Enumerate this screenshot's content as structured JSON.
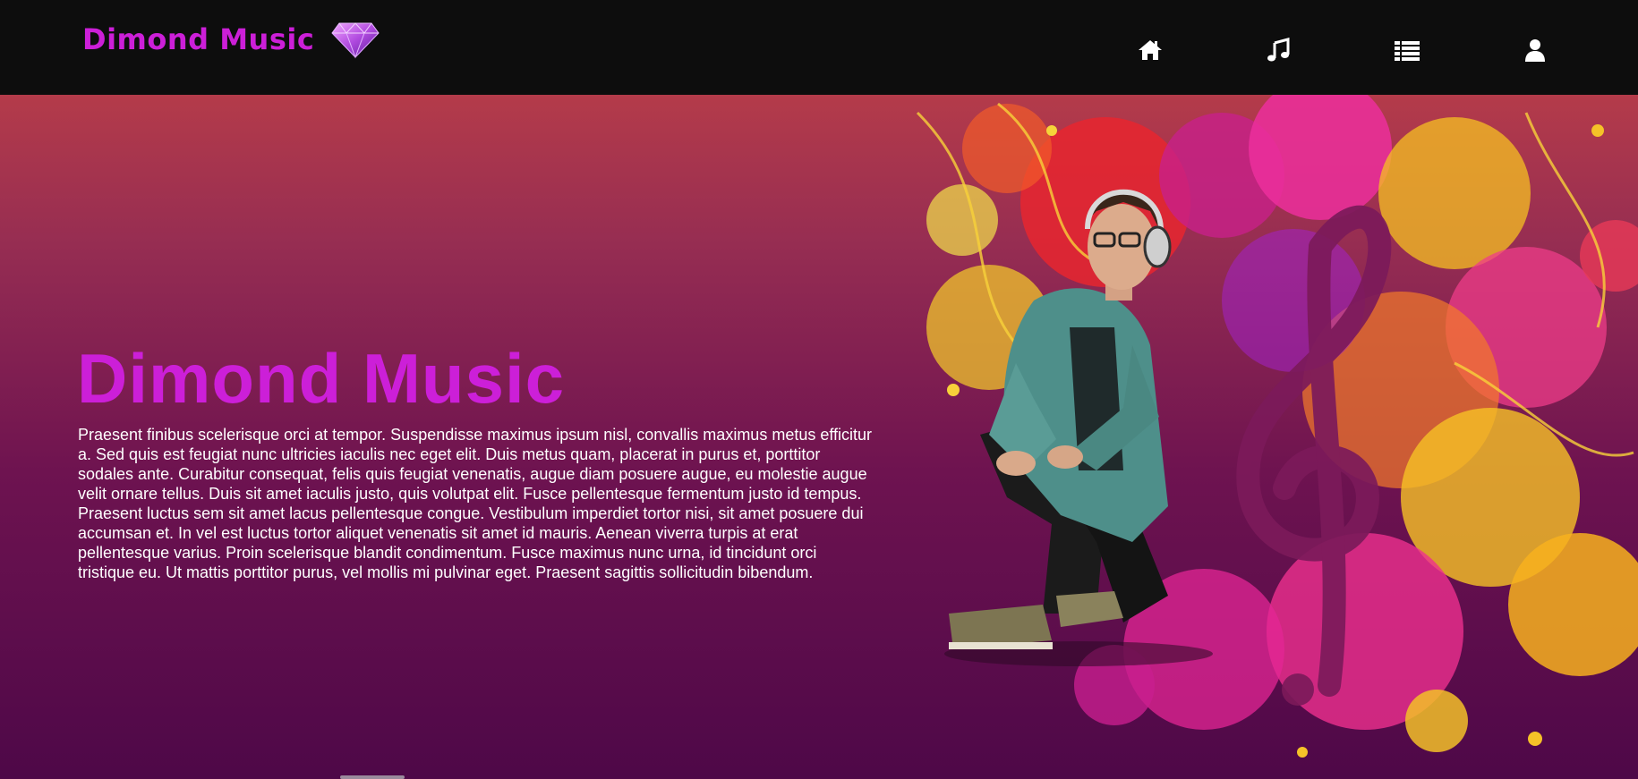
{
  "header": {
    "brand": "Dimond Music",
    "logo_icon": "diamond-icon",
    "nav": [
      {
        "name": "nav-home",
        "icon": "home-icon"
      },
      {
        "name": "nav-music",
        "icon": "music-note-icon"
      },
      {
        "name": "nav-list",
        "icon": "list-icon"
      },
      {
        "name": "nav-profile",
        "icon": "user-icon"
      }
    ]
  },
  "hero": {
    "title": "Dimond Music",
    "body": "Praesent finibus scelerisque orci at tempor. Suspendisse maximus ipsum nisl, convallis maximus metus efficitur a. Sed quis est feugiat nunc ultricies iaculis nec eget elit. Duis metus quam, placerat in purus et, porttitor sodales ante. Curabitur consequat, felis quis feugiat venenatis, augue diam posuere augue, eu molestie augue velit ornare tellus. Duis sit amet iaculis justo, quis volutpat elit. Fusce pellentesque fermentum justo id tempus. Praesent luctus sem sit amet lacus pellentesque congue. Vestibulum imperdiet tortor nisi, sit amet posuere dui accumsan et. In vel est luctus tortor aliquet venenatis sit amet id mauris. Aenean viverra turpis at erat pellentesque varius. Proin scelerisque blandit condimentum. Fusce maximus nunc urna, id tincidunt orci tristique eu. Ut mattis porttitor purus, vel mollis mi pulvinar eget. Praesent sagittis sollicitudin bibendum.",
    "image_icon": "man-with-headphones-music-splash-illustration"
  },
  "colors": {
    "brand": "#cc1fd8",
    "header_bg": "#0d0d0d",
    "hero_top": "#b43b4a",
    "hero_bottom": "#4e0848"
  }
}
